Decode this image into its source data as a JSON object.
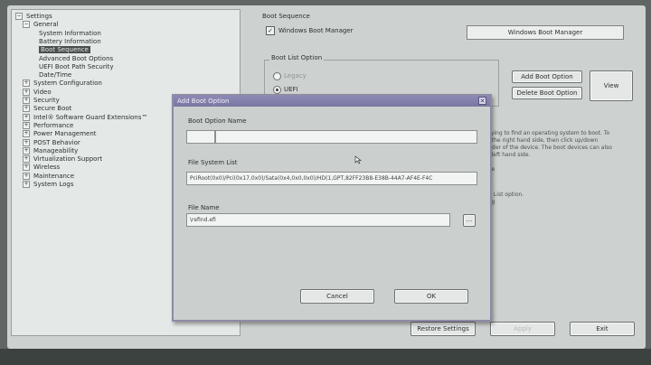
{
  "tree": {
    "items": [
      {
        "label": "Settings",
        "level": 0,
        "expander": "−"
      },
      {
        "label": "General",
        "level": 1,
        "expander": "−"
      },
      {
        "label": "System Information",
        "level": 2
      },
      {
        "label": "Battery Information",
        "level": 2
      },
      {
        "label": "Boot Sequence",
        "level": 2,
        "selected": true
      },
      {
        "label": "Advanced Boot Options",
        "level": 2
      },
      {
        "label": "UEFI Boot Path Security",
        "level": 2
      },
      {
        "label": "Date/Time",
        "level": 2
      },
      {
        "label": "System Configuration",
        "level": 1,
        "expander": "+"
      },
      {
        "label": "Video",
        "level": 1,
        "expander": "+"
      },
      {
        "label": "Security",
        "level": 1,
        "expander": "+"
      },
      {
        "label": "Secure Boot",
        "level": 1,
        "expander": "+"
      },
      {
        "label": "Intel® Software Guard Extensions™",
        "level": 1,
        "expander": "+"
      },
      {
        "label": "Performance",
        "level": 1,
        "expander": "+"
      },
      {
        "label": "Power Management",
        "level": 1,
        "expander": "+"
      },
      {
        "label": "POST Behavior",
        "level": 1,
        "expander": "+"
      },
      {
        "label": "Manageability",
        "level": 1,
        "expander": "+"
      },
      {
        "label": "Virtualization Support",
        "level": 1,
        "expander": "+"
      },
      {
        "label": "Wireless",
        "level": 1,
        "expander": "+"
      },
      {
        "label": "Maintenance",
        "level": 1,
        "expander": "+"
      },
      {
        "label": "System Logs",
        "level": 1,
        "expander": "+"
      }
    ]
  },
  "boot": {
    "section_title": "Boot Sequence",
    "entry_label": "Windows Boot Manager",
    "entry_checked": "✓",
    "entry_value": "Windows Boot Manager",
    "list_option_title": "Boot List Option",
    "legacy_label": "Legacy",
    "uefi_label": "UEFI",
    "add_button": "Add Boot Option",
    "delete_button": "Delete Boot Option",
    "view_button": "View"
  },
  "info": {
    "line1": "trying to find an operating system to boot. To",
    "line2": "n the right hand side, then click up/down",
    "line3": "order of the device. The boot devices can also",
    "line4": "e left hand side.",
    "line5": "ide",
    "line6": "d",
    "line7": "d",
    "line8": "ot List option.",
    "line9": "ing"
  },
  "footer": {
    "restore_button": "Restore Settings",
    "apply_button": "Apply",
    "exit_button": "Exit"
  },
  "dialog": {
    "title": "Add Boot Option",
    "close_glyph": "✕",
    "name_label": "Boot Option Name",
    "name_value": "",
    "fs_label": "File System List",
    "fs_value": "PciRoot(0x0)/Pci(0x17,0x0)/Sata(0x4,0x0,0x0)/HD(1,GPT,82FF23B8-E38B-44A7-AF4E-F4C",
    "file_label": "File Name",
    "file_value": "\\refind.efi",
    "browse_glyph": "...",
    "cancel_button": "Cancel",
    "ok_button": "OK"
  }
}
